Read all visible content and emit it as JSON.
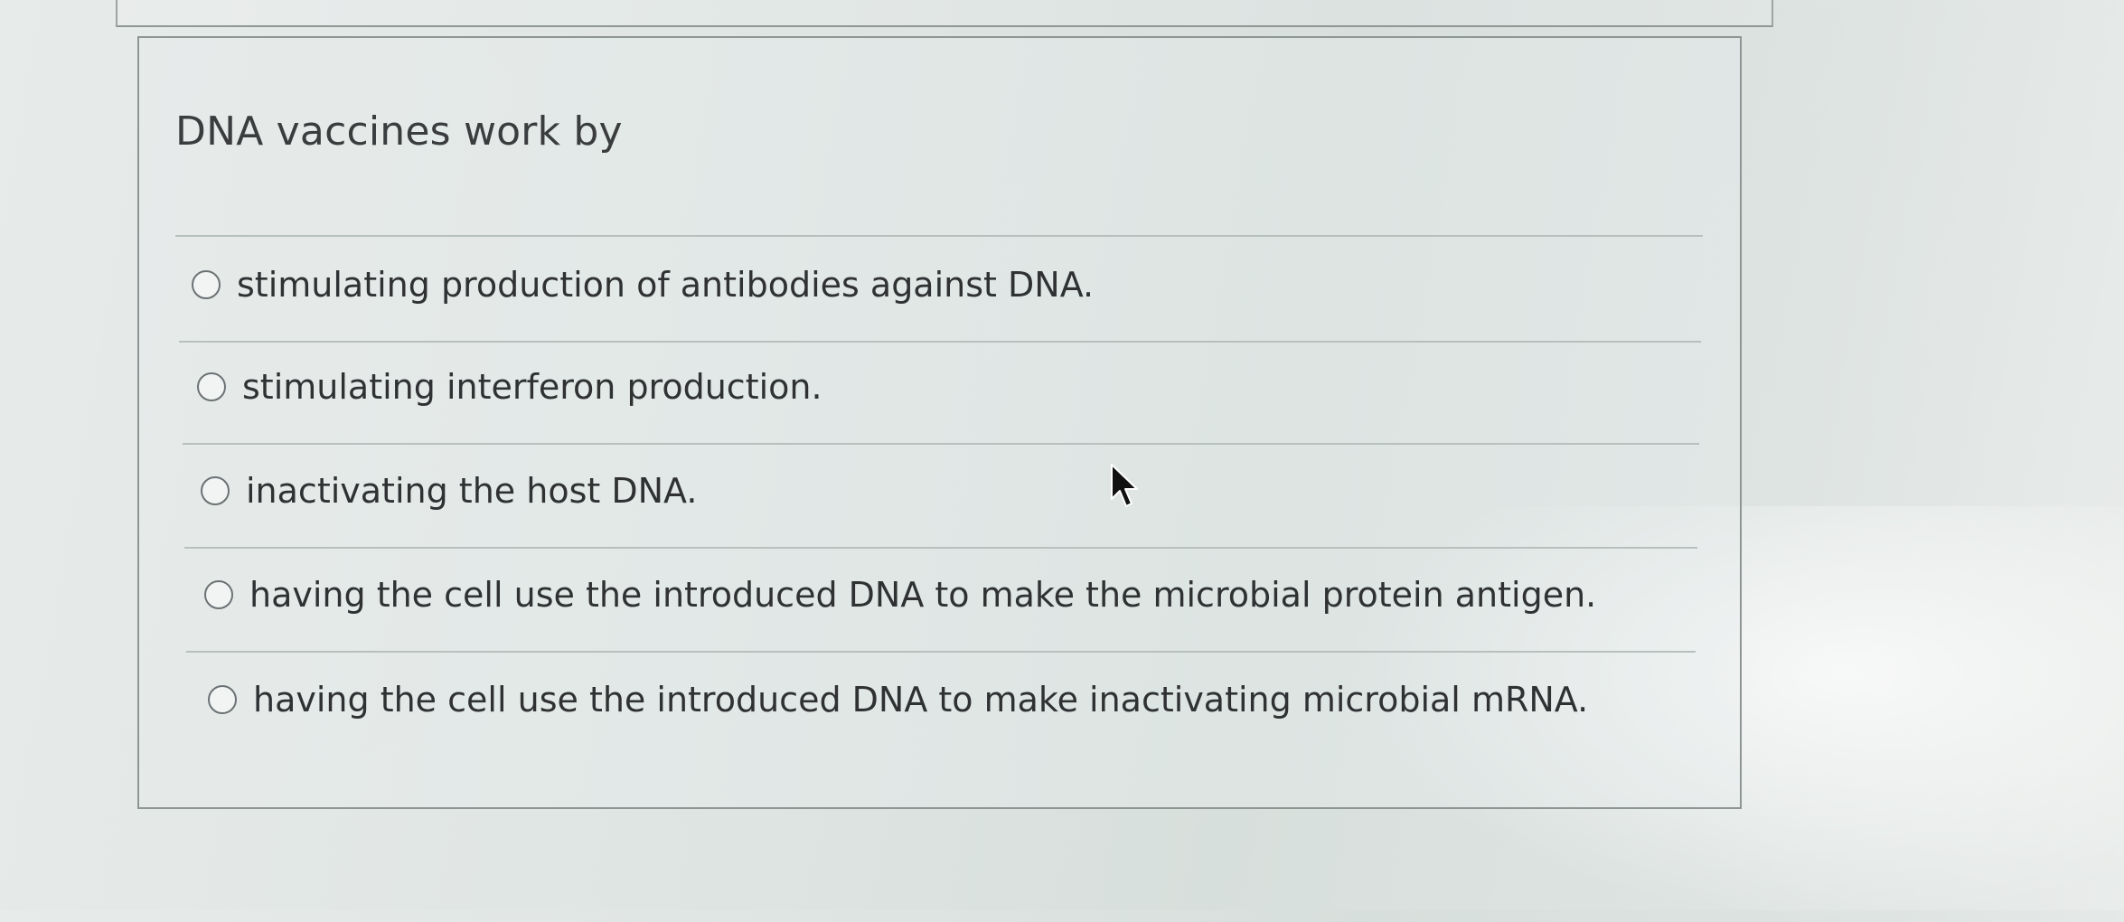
{
  "question": {
    "text": "DNA vaccines work by"
  },
  "options": [
    {
      "label": "stimulating production of antibodies against DNA.",
      "selected": false
    },
    {
      "label": "stimulating interferon production.",
      "selected": false
    },
    {
      "label": "inactivating the host DNA.",
      "selected": false
    },
    {
      "label": "having the cell use the introduced DNA to make the microbial protein antigen.",
      "selected": false
    },
    {
      "label": "having the cell use the introduced DNA to make inactivating microbial mRNA.",
      "selected": false
    }
  ],
  "icons": {
    "cursor": "mouse-pointer-icon",
    "radio": "radio-button-unselected-icon"
  },
  "colors": {
    "text": "#2f3133",
    "border": "#8e9694",
    "background": "#dfe5e3"
  }
}
